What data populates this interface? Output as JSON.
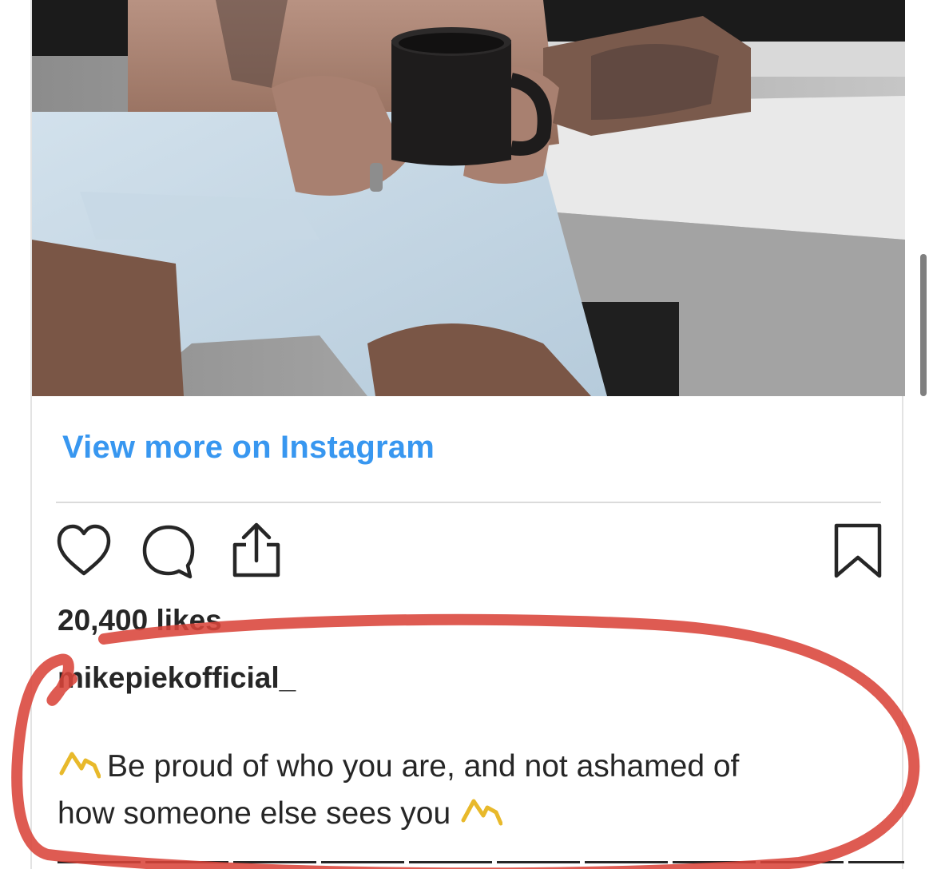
{
  "embed": {
    "view_more_label": "View more on Instagram",
    "likes_text": "20,400 likes",
    "username": "mikepiekofficial_",
    "caption_line1": "Be proud of who you are, and not ashamed of",
    "caption_line2": "how someone else sees you"
  },
  "icons": {
    "like": "heart-icon",
    "comment": "comment-bubble-icon",
    "share": "share-upload-icon",
    "save": "bookmark-icon",
    "caption_emoji": "flexed-arm-emoji"
  },
  "colors": {
    "link": "#3897f0",
    "text": "#262626",
    "divider": "#dbdbdb",
    "annotation": "#d9443a"
  }
}
